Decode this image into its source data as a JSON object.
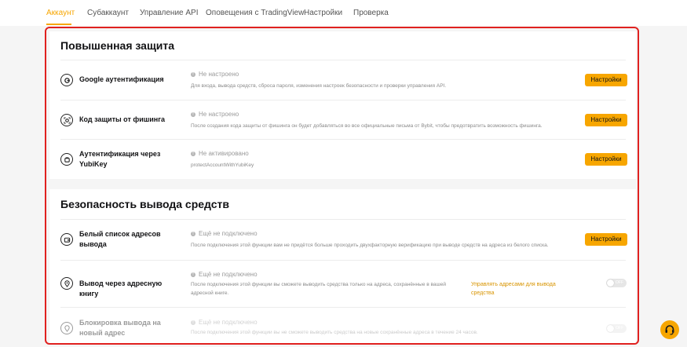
{
  "tabs": [
    {
      "label": "Аккаунт",
      "active": true
    },
    {
      "label": "Субаккаунт"
    },
    {
      "label": "Управление API"
    },
    {
      "label": "Оповещения с TradingView"
    },
    {
      "label": "Настройки"
    },
    {
      "label": "Проверка"
    }
  ],
  "colors": {
    "accent": "#f7a600",
    "highlight_border": "#e0211f"
  },
  "advanced": {
    "title": "Повышенная защита",
    "rows": [
      {
        "icon": "google-authenticator-icon",
        "title": "Google аутентификация",
        "status": "Не настроено",
        "desc": "Для входа, вывода средств, сброса пароля, изменения настроек безопасности и проверки управления API.",
        "button": "Настройки"
      },
      {
        "icon": "anti-phishing-icon",
        "title": "Код защиты от фишинга",
        "status": "Не настроено",
        "desc": "После создания кода защиты от фишинга он будет добавляться во все официальные письма от Bybit, чтобы предотвратить возможность фишинга.",
        "button": "Настройки"
      },
      {
        "icon": "yubikey-icon",
        "title": "Аутентификация через YubiKey",
        "status": "Не активировано",
        "desc": "protectAccountWithYubiKey",
        "button": "Настройки"
      }
    ]
  },
  "withdrawal": {
    "title": "Безопасность вывода средств",
    "rows": [
      {
        "icon": "wallet-icon",
        "title": "Белый список адресов вывода",
        "status": "Ещё не подключено",
        "desc": "После подключения этой функции вам не придётся больше проходить двухфакторную верификацию при выводе средств на адреса из белого списка.",
        "button": "Настройки"
      },
      {
        "icon": "location-pin-icon",
        "title": "Вывод через адресную книгу",
        "status": "Ещё не подключено",
        "desc": "После подключения этой функции вы сможете выводить средства только на адреса, сохранённые в вашей адресной книге.",
        "link": "Управлять адресами для вывода средства",
        "toggle": "OFF"
      },
      {
        "icon": "lock-pin-icon",
        "title": "Блокировка вывода на новый адрес",
        "status": "Ещё не подключено",
        "desc": "После подключения этой функции вы не сможете выводить средства на новые сохранённые адреса в течение 24 часов.",
        "toggle": "OFF"
      }
    ]
  },
  "support": {
    "icon": "headset-icon"
  }
}
